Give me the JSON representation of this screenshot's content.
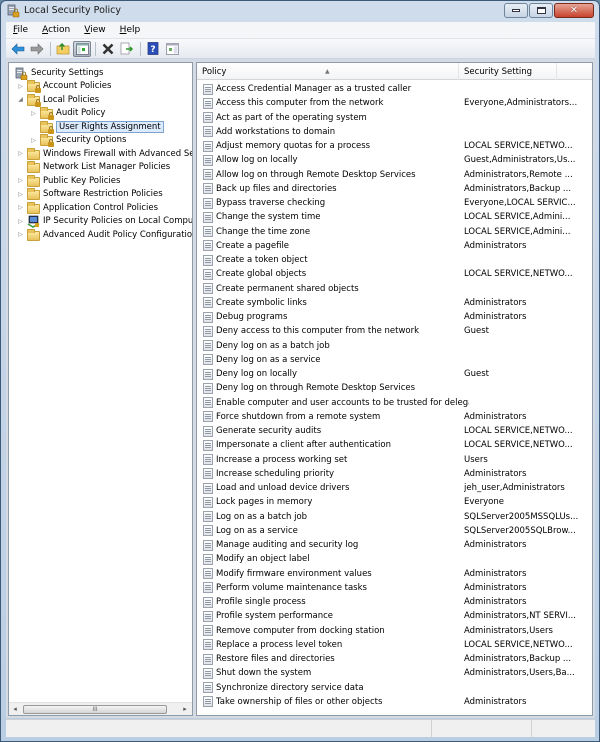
{
  "window": {
    "title": "Local Security Policy",
    "icon": "security-policy-icon",
    "controls": [
      "minimize",
      "maximize",
      "close"
    ]
  },
  "menubar": {
    "items": [
      {
        "label": "File",
        "accel": "F"
      },
      {
        "label": "Action",
        "accel": "A"
      },
      {
        "label": "View",
        "accel": "V"
      },
      {
        "label": "Help",
        "accel": "H"
      }
    ]
  },
  "toolbar": {
    "buttons": [
      "back-arrow-icon",
      "forward-arrow-icon",
      "up-folder-icon",
      "show-hide-tree-icon",
      "delete-icon",
      "export-list-icon",
      "help-icon",
      "show-hide-action-pane-icon"
    ]
  },
  "tree": {
    "items": [
      {
        "label": "Security Settings",
        "level": 0,
        "expander": "none",
        "icon": "security-settings-icon"
      },
      {
        "label": "Account Policies",
        "level": 1,
        "expander": "collapsed",
        "icon": "locked-folder-icon"
      },
      {
        "label": "Local Policies",
        "level": 1,
        "expander": "expanded",
        "icon": "locked-folder-icon"
      },
      {
        "label": "Audit Policy",
        "level": 2,
        "expander": "collapsed",
        "icon": "locked-folder-icon"
      },
      {
        "label": "User Rights Assignment",
        "level": 2,
        "expander": "none",
        "icon": "locked-folder-icon",
        "selected": true
      },
      {
        "label": "Security Options",
        "level": 2,
        "expander": "collapsed",
        "icon": "locked-folder-icon"
      },
      {
        "label": "Windows Firewall with Advanced Secu",
        "level": 1,
        "expander": "collapsed",
        "icon": "folder-icon"
      },
      {
        "label": "Network List Manager Policies",
        "level": 1,
        "expander": "none",
        "icon": "folder-icon"
      },
      {
        "label": "Public Key Policies",
        "level": 1,
        "expander": "collapsed",
        "icon": "folder-icon"
      },
      {
        "label": "Software Restriction Policies",
        "level": 1,
        "expander": "collapsed",
        "icon": "folder-icon"
      },
      {
        "label": "Application Control Policies",
        "level": 1,
        "expander": "collapsed",
        "icon": "folder-icon"
      },
      {
        "label": "IP Security Policies on Local Compute",
        "level": 1,
        "expander": "collapsed",
        "icon": "ip-security-icon"
      },
      {
        "label": "Advanced Audit Policy Configuration",
        "level": 1,
        "expander": "collapsed",
        "icon": "folder-icon"
      }
    ]
  },
  "list": {
    "columns": [
      {
        "label": "Policy",
        "sorted": "ascending"
      },
      {
        "label": "Security Setting"
      }
    ],
    "rows": [
      {
        "policy": "Access Credential Manager as a trusted caller",
        "setting": ""
      },
      {
        "policy": "Access this computer from the network",
        "setting": "Everyone,Administrators..."
      },
      {
        "policy": "Act as part of the operating system",
        "setting": ""
      },
      {
        "policy": "Add workstations to domain",
        "setting": ""
      },
      {
        "policy": "Adjust memory quotas for a process",
        "setting": "LOCAL SERVICE,NETWO..."
      },
      {
        "policy": "Allow log on locally",
        "setting": "Guest,Administrators,Us..."
      },
      {
        "policy": "Allow log on through Remote Desktop Services",
        "setting": "Administrators,Remote ..."
      },
      {
        "policy": "Back up files and directories",
        "setting": "Administrators,Backup ..."
      },
      {
        "policy": "Bypass traverse checking",
        "setting": "Everyone,LOCAL SERVIC..."
      },
      {
        "policy": "Change the system time",
        "setting": "LOCAL SERVICE,Admini..."
      },
      {
        "policy": "Change the time zone",
        "setting": "LOCAL SERVICE,Admini..."
      },
      {
        "policy": "Create a pagefile",
        "setting": "Administrators"
      },
      {
        "policy": "Create a token object",
        "setting": ""
      },
      {
        "policy": "Create global objects",
        "setting": "LOCAL SERVICE,NETWO..."
      },
      {
        "policy": "Create permanent shared objects",
        "setting": ""
      },
      {
        "policy": "Create symbolic links",
        "setting": "Administrators"
      },
      {
        "policy": "Debug programs",
        "setting": "Administrators"
      },
      {
        "policy": "Deny access to this computer from the network",
        "setting": "Guest"
      },
      {
        "policy": "Deny log on as a batch job",
        "setting": ""
      },
      {
        "policy": "Deny log on as a service",
        "setting": ""
      },
      {
        "policy": "Deny log on locally",
        "setting": "Guest"
      },
      {
        "policy": "Deny log on through Remote Desktop Services",
        "setting": ""
      },
      {
        "policy": "Enable computer and user accounts to be trusted for delega...",
        "setting": ""
      },
      {
        "policy": "Force shutdown from a remote system",
        "setting": "Administrators"
      },
      {
        "policy": "Generate security audits",
        "setting": "LOCAL SERVICE,NETWO..."
      },
      {
        "policy": "Impersonate a client after authentication",
        "setting": "LOCAL SERVICE,NETWO..."
      },
      {
        "policy": "Increase a process working set",
        "setting": "Users"
      },
      {
        "policy": "Increase scheduling priority",
        "setting": "Administrators"
      },
      {
        "policy": "Load and unload device drivers",
        "setting": "jeh_user,Administrators"
      },
      {
        "policy": "Lock pages in memory",
        "setting": "Everyone"
      },
      {
        "policy": "Log on as a batch job",
        "setting": "SQLServer2005MSSQLUs..."
      },
      {
        "policy": "Log on as a service",
        "setting": "SQLServer2005SQLBrow..."
      },
      {
        "policy": "Manage auditing and security log",
        "setting": "Administrators"
      },
      {
        "policy": "Modify an object label",
        "setting": ""
      },
      {
        "policy": "Modify firmware environment values",
        "setting": "Administrators"
      },
      {
        "policy": "Perform volume maintenance tasks",
        "setting": "Administrators"
      },
      {
        "policy": "Profile single process",
        "setting": "Administrators"
      },
      {
        "policy": "Profile system performance",
        "setting": "Administrators,NT SERVI..."
      },
      {
        "policy": "Remove computer from docking station",
        "setting": "Administrators,Users"
      },
      {
        "policy": "Replace a process level token",
        "setting": "LOCAL SERVICE,NETWO..."
      },
      {
        "policy": "Restore files and directories",
        "setting": "Administrators,Backup ..."
      },
      {
        "policy": "Shut down the system",
        "setting": "Administrators,Users,Ba..."
      },
      {
        "policy": "Synchronize directory service data",
        "setting": ""
      },
      {
        "policy": "Take ownership of files or other objects",
        "setting": "Administrators"
      }
    ]
  },
  "tree_scrollbar": {
    "grip": "III"
  },
  "statusbar": {
    "segments": [
      "",
      "",
      ""
    ]
  }
}
